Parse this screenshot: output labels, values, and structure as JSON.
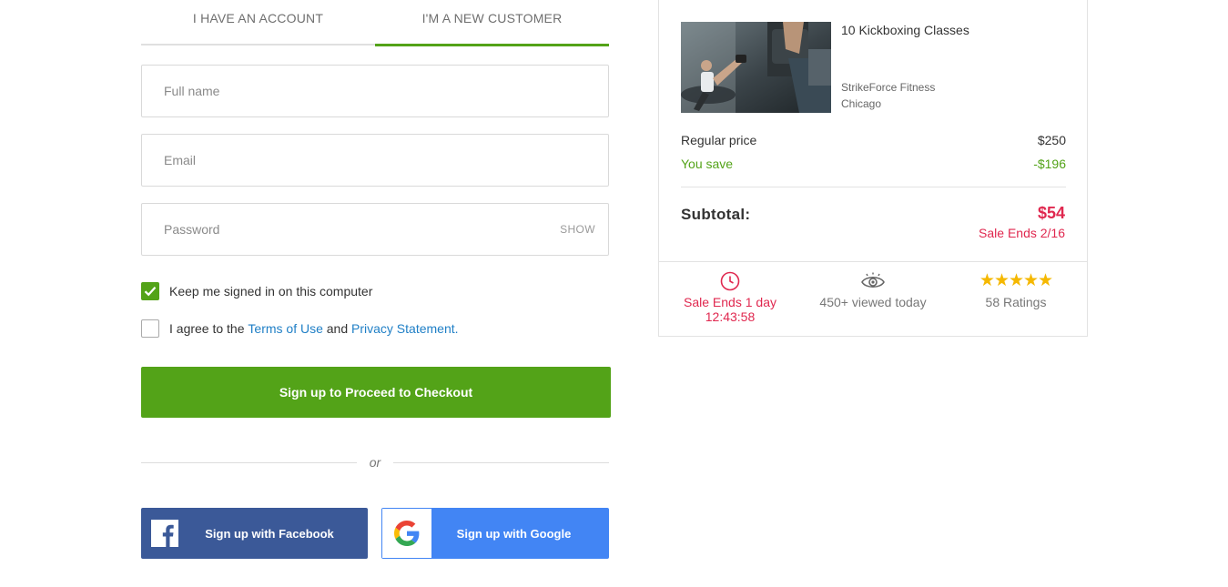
{
  "tabs": [
    {
      "label": "I HAVE AN ACCOUNT",
      "active": false
    },
    {
      "label": "I'M A NEW CUSTOMER",
      "active": true
    }
  ],
  "form": {
    "full_name_placeholder": "Full name",
    "email_placeholder": "Email",
    "password_placeholder": "Password",
    "show_label": "SHOW",
    "keep_signed_in": "Keep me signed in on this computer",
    "agree_prefix": "I agree to the",
    "terms_link": "Terms of Use",
    "agree_and": "and",
    "privacy_link": "Privacy Statement.",
    "submit_label": "Sign up to Proceed to Checkout",
    "or_label": "or",
    "facebook_label": "Sign up with Facebook",
    "google_label": "Sign up with Google"
  },
  "deal": {
    "title": "10 Kickboxing Classes",
    "merchant": "StrikeForce Fitness",
    "location": "Chicago",
    "regular_price_label": "Regular price",
    "regular_price": "$250",
    "you_save_label": "You save",
    "you_save": "-$196",
    "subtotal_label": "Subtotal:",
    "subtotal": "$54",
    "sale_ends": "Sale Ends 2/16"
  },
  "stats": {
    "timer_line1": "Sale Ends 1 day",
    "timer_line2": "12:43:58",
    "views": "450+ viewed today",
    "ratings": "58 Ratings",
    "stars": "★★★★★"
  },
  "colors": {
    "accent_green": "#53a318",
    "sale_red": "#e0284f",
    "link_blue": "#1f7fc6",
    "facebook_blue": "#3b5998",
    "google_blue": "#4285f4",
    "star_gold": "#f5b800"
  }
}
